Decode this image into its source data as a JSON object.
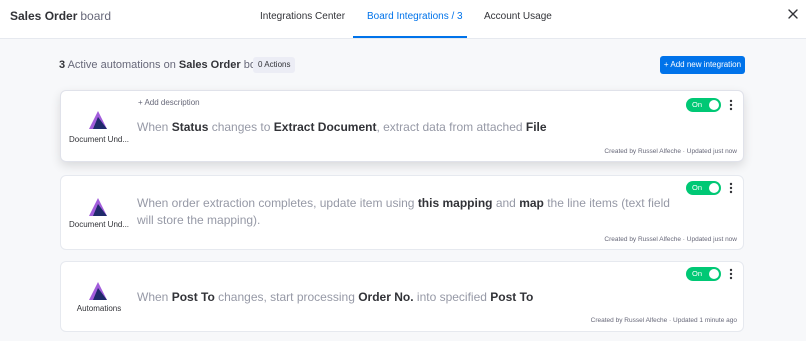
{
  "header": {
    "board_name": "Sales Order",
    "board_word": "board",
    "tabs": [
      {
        "label": "Integrations Center"
      },
      {
        "label": "Board Integrations / 3"
      },
      {
        "label": "Account Usage"
      }
    ],
    "active_tab_index": 1
  },
  "summary": {
    "count": "3",
    "text1": "Active automations on",
    "board": "Sales Order",
    "text2": "board",
    "actions_badge": "0 Actions",
    "add_button": "+ Add new integration"
  },
  "cards": [
    {
      "app_name": "Document Und...",
      "add_description": "+ Add description",
      "toggle": "On",
      "sentence": [
        {
          "t": "When ",
          "b": false
        },
        {
          "t": "Status",
          "b": true
        },
        {
          "t": " changes to ",
          "b": false
        },
        {
          "t": "Extract Document",
          "b": true
        },
        {
          "t": ", extract data from attached ",
          "b": false
        },
        {
          "t": "File",
          "b": true
        }
      ],
      "meta": "Created by Russel Alfeche · Updated just now"
    },
    {
      "app_name": "Document Und...",
      "toggle": "On",
      "sentence": [
        {
          "t": "When order extraction completes, update item using ",
          "b": false
        },
        {
          "t": "this mapping",
          "b": true
        },
        {
          "t": " and ",
          "b": false
        },
        {
          "t": "map",
          "b": true
        },
        {
          "t": " the line items (text field will store the mapping).",
          "b": false
        }
      ],
      "meta": "Created by Russel Alfeche · Updated just now"
    },
    {
      "app_name": "Automations",
      "toggle": "On",
      "sentence": [
        {
          "t": "When ",
          "b": false
        },
        {
          "t": "Post To",
          "b": true
        },
        {
          "t": " changes, start processing ",
          "b": false
        },
        {
          "t": "Order No.",
          "b": true
        },
        {
          "t": " into specified ",
          "b": false
        },
        {
          "t": "Post To",
          "b": true
        }
      ],
      "meta": "Created by Russel Alfeche · Updated 1 minute ago"
    }
  ],
  "colors": {
    "accent": "#0073ea",
    "toggle_on": "#00c875",
    "logo_light": "#a25ddc",
    "logo_dark": "#1f2a6b"
  },
  "icons": [
    "close-icon",
    "app-logo-icon",
    "more-options-icon"
  ]
}
